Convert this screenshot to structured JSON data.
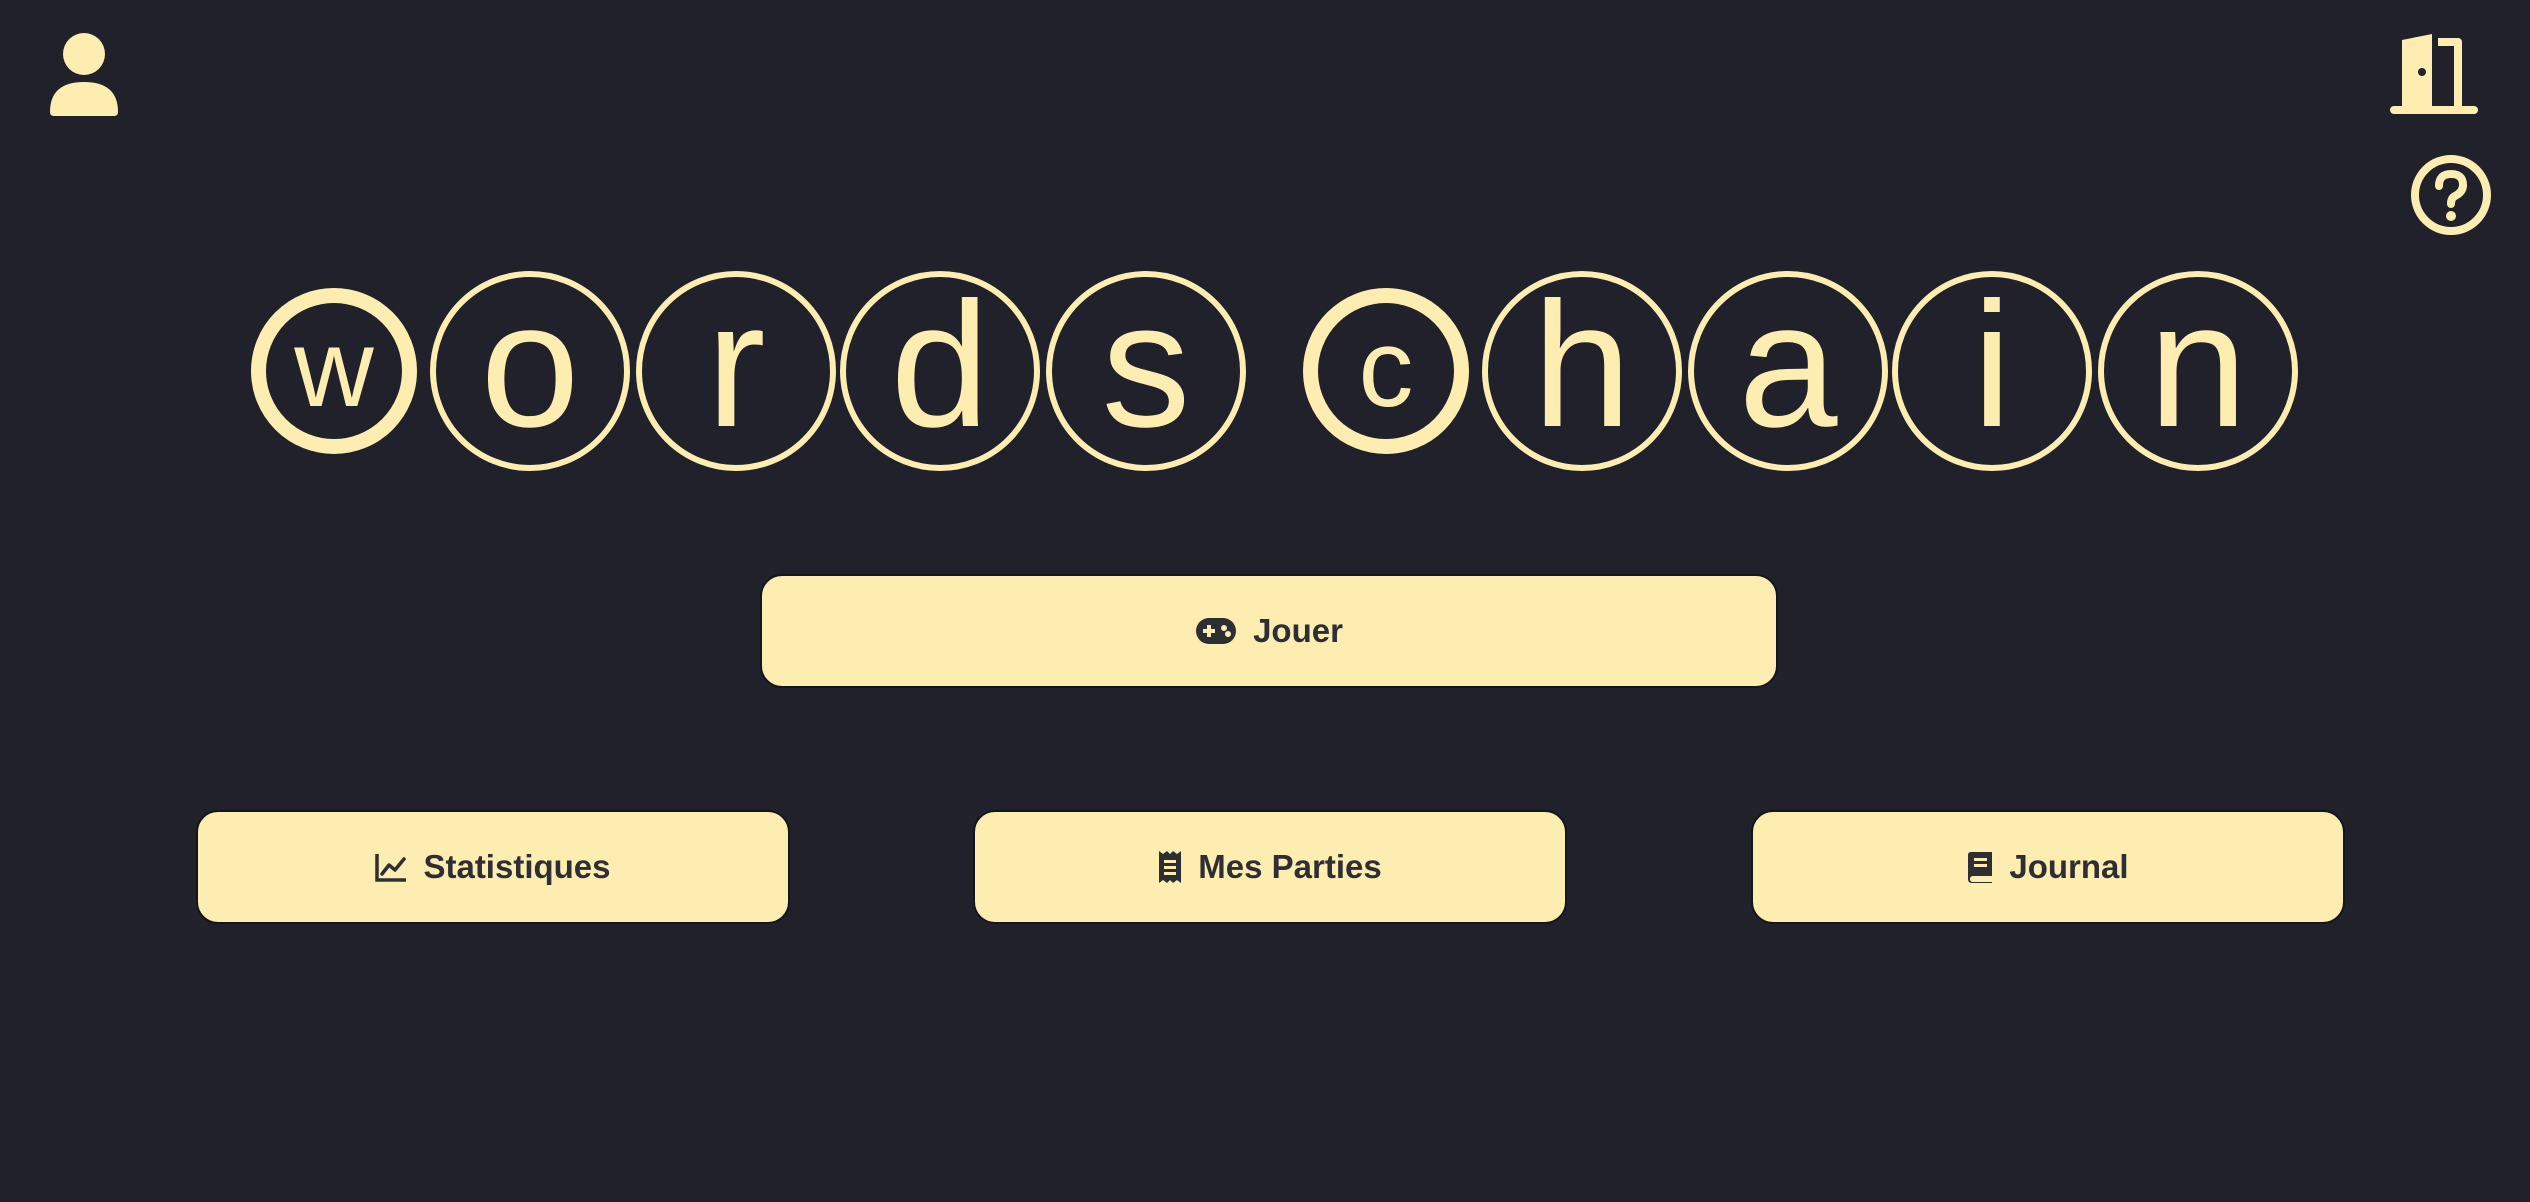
{
  "colors": {
    "background": "#20212a",
    "accent": "#fdedb0",
    "button_text": "#2e2f35"
  },
  "top_bar": {
    "profile_icon": "user-icon",
    "logout_icon": "door-exit-icon",
    "help_icon": "question-circle-icon"
  },
  "title": {
    "word1": [
      "w",
      "o",
      "r",
      "d",
      "s"
    ],
    "word2": [
      "c",
      "h",
      "a",
      "i",
      "n"
    ]
  },
  "buttons": {
    "play": {
      "label": "Jouer",
      "icon": "gamepad-icon"
    },
    "stats": {
      "label": "Statistiques",
      "icon": "line-chart-icon"
    },
    "games": {
      "label": "Mes Parties",
      "icon": "receipt-icon"
    },
    "journal": {
      "label": "Journal",
      "icon": "book-icon"
    }
  }
}
